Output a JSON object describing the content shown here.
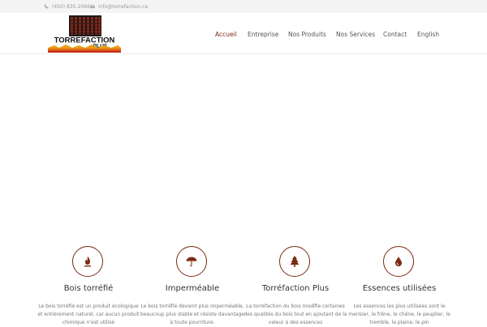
{
  "topbar": {
    "phone": "(450) 835-2066",
    "email": "info@torrefaction.ca"
  },
  "logo": {
    "line1": "TORREFACTION",
    "line2": "PLUS"
  },
  "nav": {
    "items": [
      {
        "label": "Accueil",
        "active": true
      },
      {
        "label": "Entreprise",
        "active": false
      },
      {
        "label": "Nos Produits",
        "active": false
      },
      {
        "label": "Nos Services",
        "active": false
      },
      {
        "label": "Contact",
        "active": false
      },
      {
        "label": "English",
        "active": false
      }
    ]
  },
  "features": [
    {
      "icon": "fire-icon",
      "title": "Bois torréfié",
      "text": "Le bois torréfié est un produit écologique et entièrement naturel, car aucun produit chimique n’est utilisé"
    },
    {
      "icon": "umbrella-icon",
      "title": "Imperméable",
      "text": "Le bois torréfié devient plus imperméable, beaucoup plus stable et résiste davantage à toute pourriture."
    },
    {
      "icon": "tree-icon",
      "title": "Torréfaction Plus",
      "text": "La torréfaction du bois modifie certaines des qualités du bois tout en ajoutant de la valeur à des essences"
    },
    {
      "icon": "drop-icon",
      "title": "Essences utilisées",
      "text": "Les essences les plus utilisées sont le merisier, le frêne, le chêne, le peuplier, le tremble, la plaine, le pin"
    }
  ],
  "colors": {
    "accent": "#7a2b14",
    "topbar_bg": "#f4f4f4"
  }
}
